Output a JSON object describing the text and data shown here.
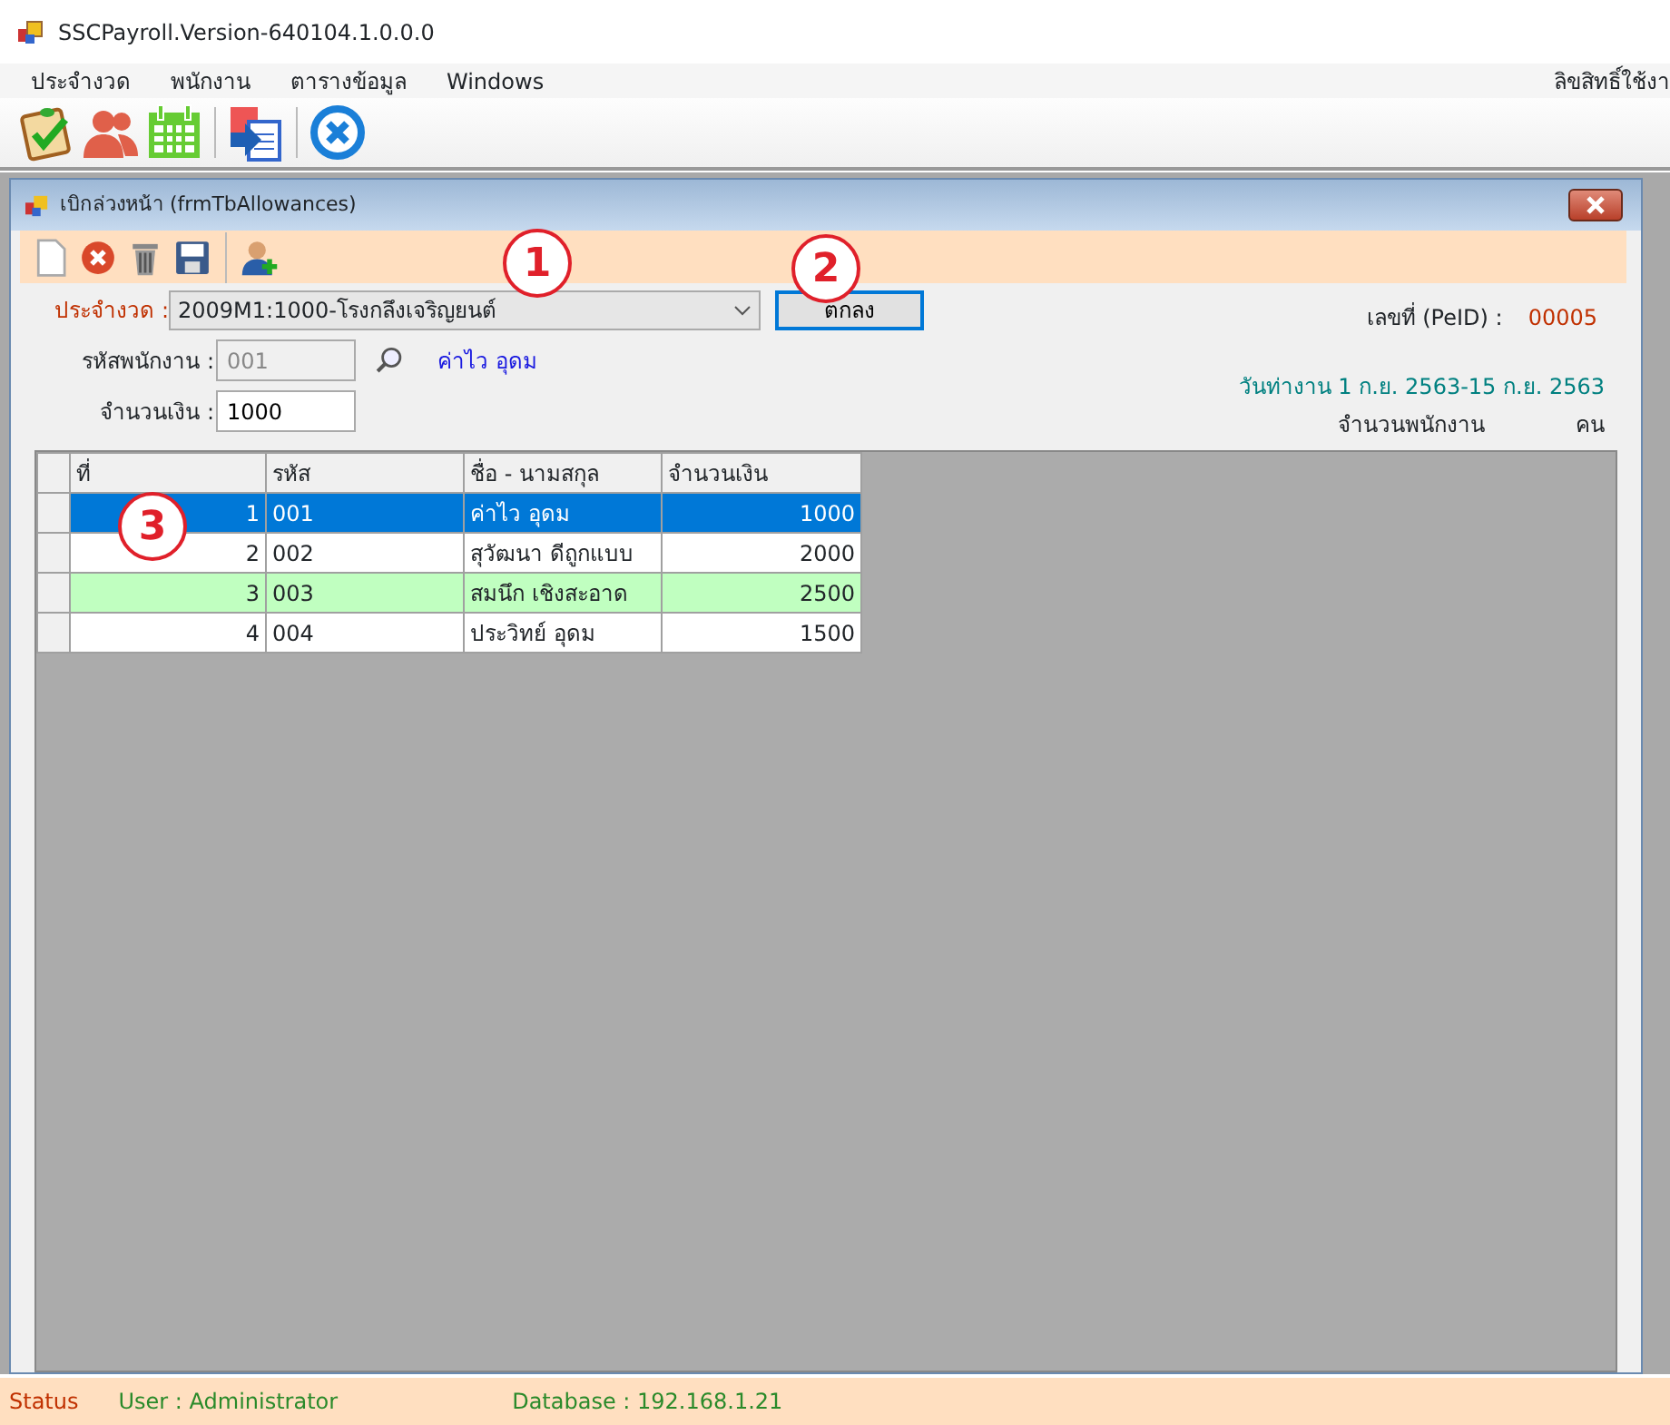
{
  "window": {
    "title": "SSCPayroll.Version-640104.1.0.0.0"
  },
  "menu": [
    {
      "label": "ประจำงวด"
    },
    {
      "label": "พนักงาน"
    },
    {
      "label": "ตารางข้อมูล"
    },
    {
      "label": "Windows"
    }
  ],
  "menu_right": "ลิขสิทธิ์ใช้งา",
  "child_window": {
    "title": "เบิกล่วงหน้า (frmTbAllowances)"
  },
  "form": {
    "period_label": "ประจำงวด :",
    "period_value": "2009M1:1000-โรงกลึงเจริญยนต์",
    "ok_button": "ตกลง",
    "peid_label": "เลขที่ (PeID) :",
    "peid_value": "00005",
    "employee_code_label": "รหัสพนักงาน :",
    "employee_code_value": "001",
    "employee_code_disabled": true,
    "employee_name": "ค่าไว อุดม",
    "amount_label": "จำนวนเงิน :",
    "amount_value": "1000",
    "work_period": "วันท่างาน 1 ก.ย. 2563-15 ก.ย. 2563",
    "employee_count_label": "จำนวนพนักงาน",
    "employee_count_unit": "คน"
  },
  "table": {
    "columns": [
      "ที่",
      "รหัส",
      "ชื่อ - นามสกุล",
      "จำนวนเงิน"
    ],
    "rows": [
      {
        "cells": [
          "1",
          "001",
          "ค่าไว อุดม",
          "1000"
        ],
        "selected": true
      },
      {
        "cells": [
          "2",
          "002",
          "สุวัฒนา   ดีถูกแบบ",
          "2000"
        ],
        "selected": false,
        "highlighted": false
      },
      {
        "cells": [
          "3",
          "003",
          "สมนึก เชิงสะอาด",
          "2500"
        ],
        "selected": false,
        "highlighted": true
      },
      {
        "cells": [
          "4",
          "004",
          "ประวิทย์ อุดม",
          "1500"
        ],
        "selected": false,
        "highlighted": false
      }
    ]
  },
  "callouts": [
    {
      "label": "1"
    },
    {
      "label": "2"
    },
    {
      "label": "3"
    }
  ],
  "status_bar": {
    "status": "Status",
    "user": "User : Administrator",
    "database": "Database : 192.168.1.21"
  }
}
